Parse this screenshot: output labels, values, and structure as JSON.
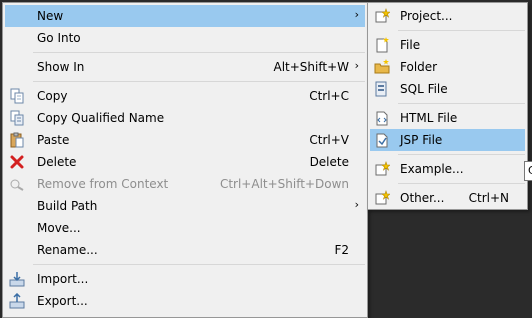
{
  "main_menu": {
    "items": [
      {
        "label": "New",
        "shortcut": "",
        "submenu": true,
        "icon": "none"
      },
      {
        "label": "Go Into",
        "shortcut": "",
        "icon": "none"
      },
      {
        "label": "Show In",
        "shortcut": "Alt+Shift+W",
        "submenu": true,
        "icon": "none"
      },
      {
        "label": "Copy",
        "shortcut": "Ctrl+C",
        "icon": "copy-icon"
      },
      {
        "label": "Copy Qualified Name",
        "shortcut": "",
        "icon": "copy-qualified-name-icon"
      },
      {
        "label": "Paste",
        "shortcut": "Ctrl+V",
        "icon": "paste-icon"
      },
      {
        "label": "Delete",
        "shortcut": "Delete",
        "icon": "delete-icon"
      },
      {
        "label": "Remove from Context",
        "shortcut": "Ctrl+Alt+Shift+Down",
        "icon": "remove-from-context-icon"
      },
      {
        "label": "Build Path",
        "shortcut": "",
        "submenu": true,
        "icon": "none"
      },
      {
        "label": "Move...",
        "shortcut": "",
        "icon": "none"
      },
      {
        "label": "Rename...",
        "shortcut": "F2",
        "icon": "none"
      },
      {
        "label": "Import...",
        "shortcut": "",
        "icon": "import-icon"
      },
      {
        "label": "Export...",
        "shortcut": "",
        "icon": "export-icon"
      }
    ]
  },
  "sub_menu": {
    "items": [
      {
        "label": "Project...",
        "shortcut": "",
        "icon": "new-project-icon"
      },
      {
        "label": "File",
        "shortcut": "",
        "icon": "new-file-icon"
      },
      {
        "label": "Folder",
        "shortcut": "",
        "icon": "new-folder-icon"
      },
      {
        "label": "SQL File",
        "shortcut": "",
        "icon": "sql-file-icon"
      },
      {
        "label": "HTML File",
        "shortcut": "",
        "icon": "html-file-icon"
      },
      {
        "label": "JSP File",
        "shortcut": "",
        "icon": "jsp-file-icon"
      },
      {
        "label": "Example...",
        "shortcut": "",
        "icon": "new-example-icon"
      },
      {
        "label": "Other...",
        "shortcut": "Ctrl+N",
        "icon": "new-other-icon"
      }
    ]
  },
  "tooltip": {
    "text": "C"
  },
  "colors": {
    "highlight": "#99c9ef",
    "menu_bg": "#f0f0f0",
    "disabled_text": "#8e8e8e"
  }
}
